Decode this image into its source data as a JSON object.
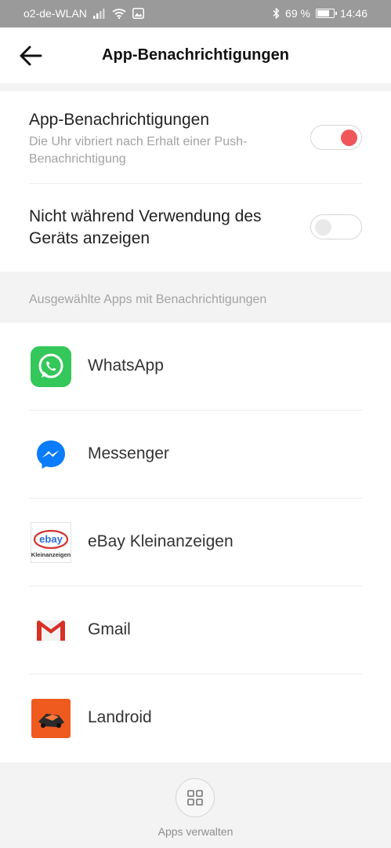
{
  "status_bar": {
    "carrier": "o2-de-WLAN",
    "battery_text": "69 %",
    "battery_level": 0.69,
    "time": "14:46",
    "icons": [
      "signal-icon",
      "wifi-icon",
      "gallery-icon",
      "bluetooth-icon",
      "battery-icon"
    ]
  },
  "header": {
    "title": "App-Benachrichtigungen",
    "back_icon": "back-arrow-icon"
  },
  "settings": [
    {
      "title": "App-Benachrichtigungen",
      "description": "Die Uhr vibriert nach Erhalt einer Push-Benachrichtigung",
      "enabled": true
    },
    {
      "title": "Nicht während Verwendung des Geräts anzeigen",
      "enabled": false
    }
  ],
  "section_label": "Ausgewählte Apps mit Benachrichtigungen",
  "apps": [
    {
      "name": "WhatsApp",
      "icon": "whatsapp-icon"
    },
    {
      "name": "Messenger",
      "icon": "messenger-icon"
    },
    {
      "name": "eBay Kleinanzeigen",
      "icon": "ebay-kleinanzeigen-icon",
      "icon_text_main": "ebay",
      "icon_text_sub": "Kleinanzeigen"
    },
    {
      "name": "Gmail",
      "icon": "gmail-icon"
    },
    {
      "name": "Landroid",
      "icon": "landroid-icon"
    }
  ],
  "footer": {
    "manage_label": "Apps verwalten",
    "manage_icon": "grid-icon"
  },
  "colors": {
    "accent": "#f0555a",
    "status_bar": "#9a9a9a",
    "whatsapp": "#34c759",
    "messenger": "#0a7cff",
    "gmail": "#d93025",
    "landroid": "#ef5a1f"
  }
}
